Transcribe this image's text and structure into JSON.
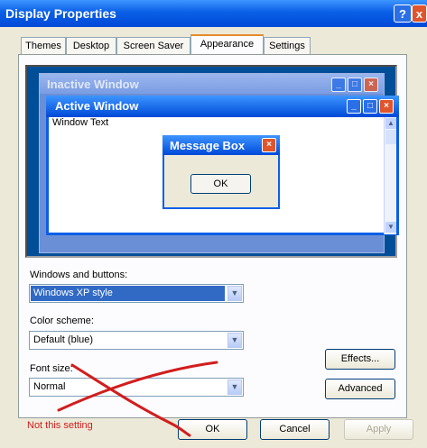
{
  "window": {
    "title": "Display Properties",
    "help": "?",
    "close": "x"
  },
  "tabs": [
    "Themes",
    "Desktop",
    "Screen Saver",
    "Appearance",
    "Settings"
  ],
  "preview": {
    "inactive_title": "Inactive Window",
    "active_title": "Active Window",
    "window_text": "Window Text",
    "msgbox_title": "Message Box",
    "msgbox_ok": "OK"
  },
  "fields": {
    "windows_buttons_label": "Windows and buttons:",
    "windows_buttons_value": "Windows XP style",
    "color_scheme_label": "Color scheme:",
    "color_scheme_value": "Default (blue)",
    "font_size_label": "Font size:",
    "font_size_value": "Normal"
  },
  "buttons": {
    "effects": "Effects...",
    "advanced": "Advanced",
    "ok": "OK",
    "cancel": "Cancel",
    "apply": "Apply"
  },
  "annotation": {
    "note": "Not this setting",
    "color": "#d21d1d"
  }
}
